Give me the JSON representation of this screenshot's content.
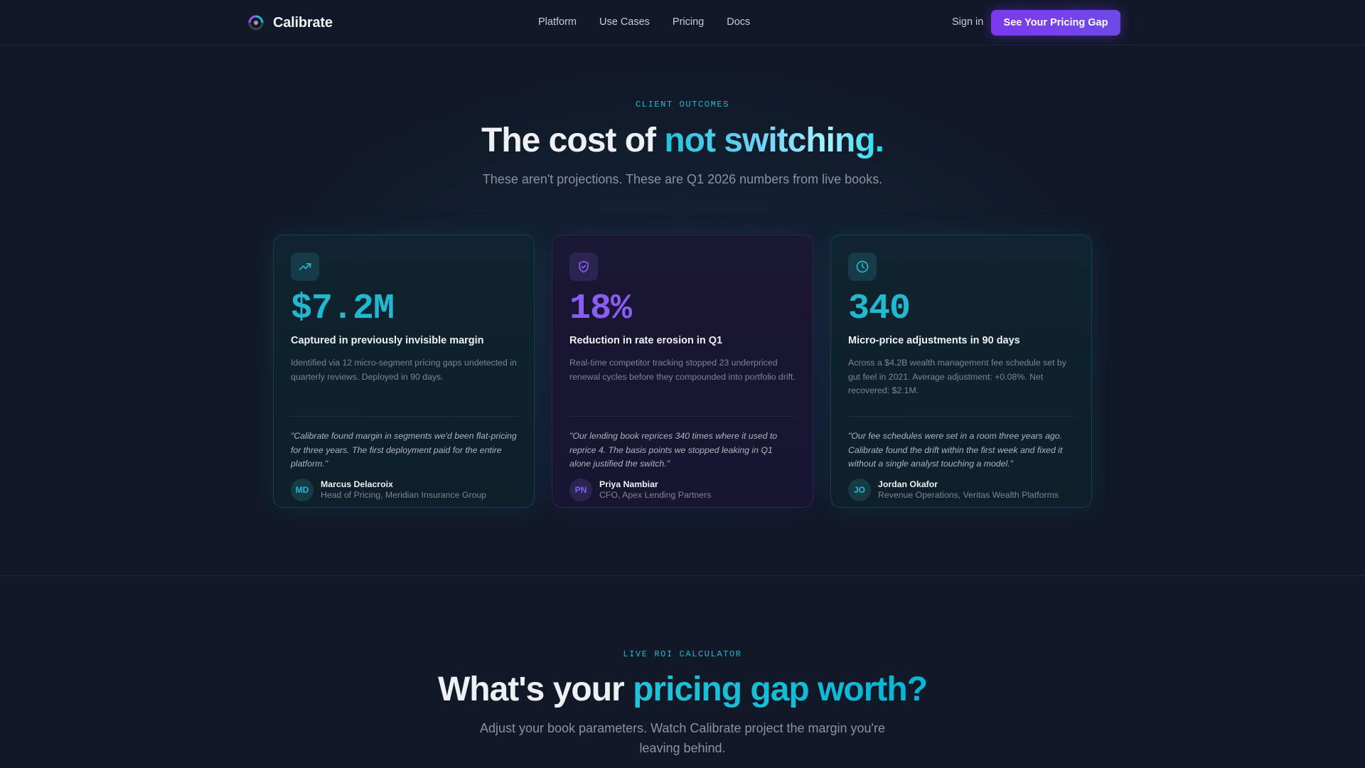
{
  "nav": {
    "brand": "Calibrate",
    "links": [
      "Platform",
      "Use Cases",
      "Pricing",
      "Docs"
    ],
    "signin": "Sign in",
    "cta": "See Your Pricing Gap"
  },
  "outcomes": {
    "eyebrow": "CLIENT OUTCOMES",
    "headline_plain": "The cost of ",
    "headline_accent": "not switching.",
    "subtitle": "These aren't projections. These are Q1 2026 numbers from live books.",
    "cards": [
      {
        "icon": "trending-up-icon",
        "stat": "$7.2M",
        "label": "Captured in previously invisible margin",
        "desc": "Identified via 12 micro-segment pricing gaps undetected in quarterly reviews. Deployed in 90 days.",
        "quote": "\"Calibrate found margin in segments we'd been flat-pricing for three years. The first deployment paid for the entire platform.\"",
        "initials": "MD",
        "name": "Marcus Delacroix",
        "role": "Head of Pricing, Meridian Insurance Group"
      },
      {
        "icon": "shield-check-icon",
        "stat": "18%",
        "label": "Reduction in rate erosion in Q1",
        "desc": "Real-time competitor tracking stopped 23 underpriced renewal cycles before they compounded into portfolio drift.",
        "quote": "\"Our lending book reprices 340 times where it used to reprice 4. The basis points we stopped leaking in Q1 alone justified the switch.\"",
        "initials": "PN",
        "name": "Priya Nambiar",
        "role": "CFO, Apex Lending Partners"
      },
      {
        "icon": "clock-icon",
        "stat": "340",
        "label": "Micro-price adjustments in 90 days",
        "desc": "Across a $4.2B wealth management fee schedule set by gut feel in 2021. Average adjustment: +0.08%. Net recovered: $2.1M.",
        "quote": "\"Our fee schedules were set in a room three years ago. Calibrate found the drift within the first week and fixed it without a single analyst touching a model.\"",
        "initials": "JO",
        "name": "Jordan Okafor",
        "role": "Revenue Operations, Veritas Wealth Platforms"
      }
    ]
  },
  "roi": {
    "eyebrow": "LIVE ROI CALCULATOR",
    "headline_plain": "What's your ",
    "headline_accent": "pricing gap worth?",
    "subtitle_line1": "Adjust your book parameters. Watch Calibrate project the margin you're",
    "subtitle_line2": "leaving behind."
  },
  "colors": {
    "background": "#111827",
    "teal_accent": "#22b8cf",
    "purple_accent": "#8b5cf6",
    "cta": "#7c3aed"
  }
}
